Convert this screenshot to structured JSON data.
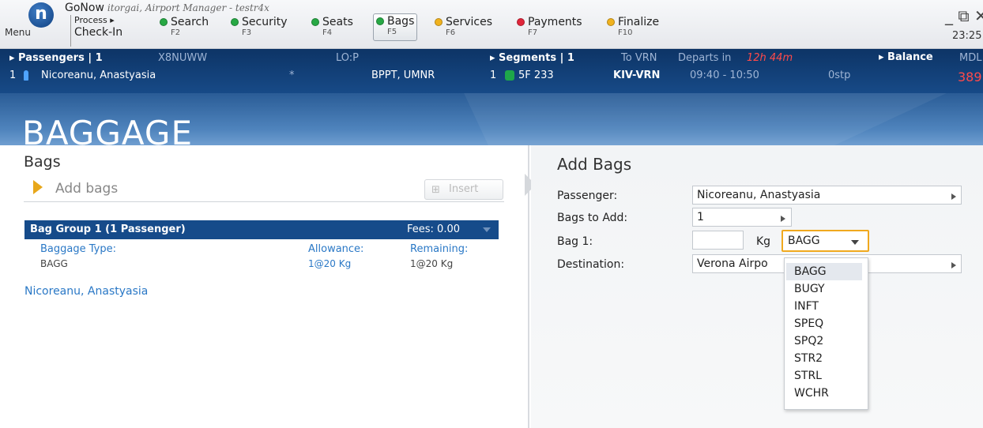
{
  "app": {
    "menu_label": "Menu",
    "logo_letter": "n",
    "title": "GoNow",
    "subtitle": "itorgai, Airport Manager - testr4x",
    "process_label": "Process ▸",
    "checkin_label": "Check-In",
    "clock": "23:25",
    "window_controls": "_ ⧉ ✕"
  },
  "steps": [
    {
      "label": "Search",
      "key": "F2",
      "color": "#27a844"
    },
    {
      "label": "Security",
      "key": "F3",
      "color": "#27a844"
    },
    {
      "label": "Seats",
      "key": "F4",
      "color": "#27a844"
    },
    {
      "label": "Bags",
      "key": "F5",
      "color": "#27a844",
      "active": true
    },
    {
      "label": "Services",
      "key": "F6",
      "color": "#f0b21e"
    },
    {
      "label": "Payments",
      "key": "F7",
      "color": "#e0253a"
    },
    {
      "label": "Finalize",
      "key": "F10",
      "color": "#f0b21e"
    }
  ],
  "info": {
    "passengers_label": "▸ Passengers | 1",
    "pnr": "X8NUWW",
    "lo": "LO:P",
    "segments_label": "▸ Segments | 1",
    "to": "To VRN",
    "departs_prefix": "Departs in",
    "departs_time": "12h 44m",
    "balance_label": "▸ Balance",
    "balance_currency": "MDL",
    "balance_amount": "389",
    "pax_index": "1",
    "pax_name": "Nicoreanu, Anastyasia",
    "pax_star": "*",
    "pax_codes": "BPPT, UMNR",
    "seg_index": "1",
    "flight": "5F 233",
    "route": "KIV-VRN",
    "time": "09:40 - 10:50",
    "stops": "0stp"
  },
  "banner": {
    "title": "BAGGAGE"
  },
  "left": {
    "title": "Bags",
    "add_bags_label": "Add bags",
    "insert_label": "Insert",
    "group_title": "Bag Group 1 (1 Passenger)",
    "group_fees": "Fees: 0.00",
    "columns": {
      "type_header": "Baggage Type:",
      "allowance_header": "Allowance:",
      "remaining_header": "Remaining:",
      "type_value": "BAGG",
      "allowance_value": "1@20 Kg",
      "remaining_value": "1@20 Kg"
    },
    "passenger_link": "Nicoreanu, Anastyasia"
  },
  "right": {
    "title": "Add Bags",
    "passenger_label": "Passenger:",
    "passenger_value": "Nicoreanu, Anastyasia",
    "bags_to_add_label": "Bags to Add:",
    "bags_to_add_value": "1",
    "bag1_label": "Bag 1:",
    "bag1_weight": "",
    "kg_label": "Kg",
    "bag_type_value": "BAGG",
    "destination_label": "Destination:",
    "destination_value": "Verona Airpo",
    "dropdown_options": [
      "BAGG",
      "BUGY",
      "INFT",
      "SPEQ",
      "SPQ2",
      "STR2",
      "STRL",
      "WCHR"
    ]
  },
  "colors": {
    "accent": "#f0a91e",
    "header_blue": "#164b8a",
    "link_blue": "#2a78c6"
  }
}
